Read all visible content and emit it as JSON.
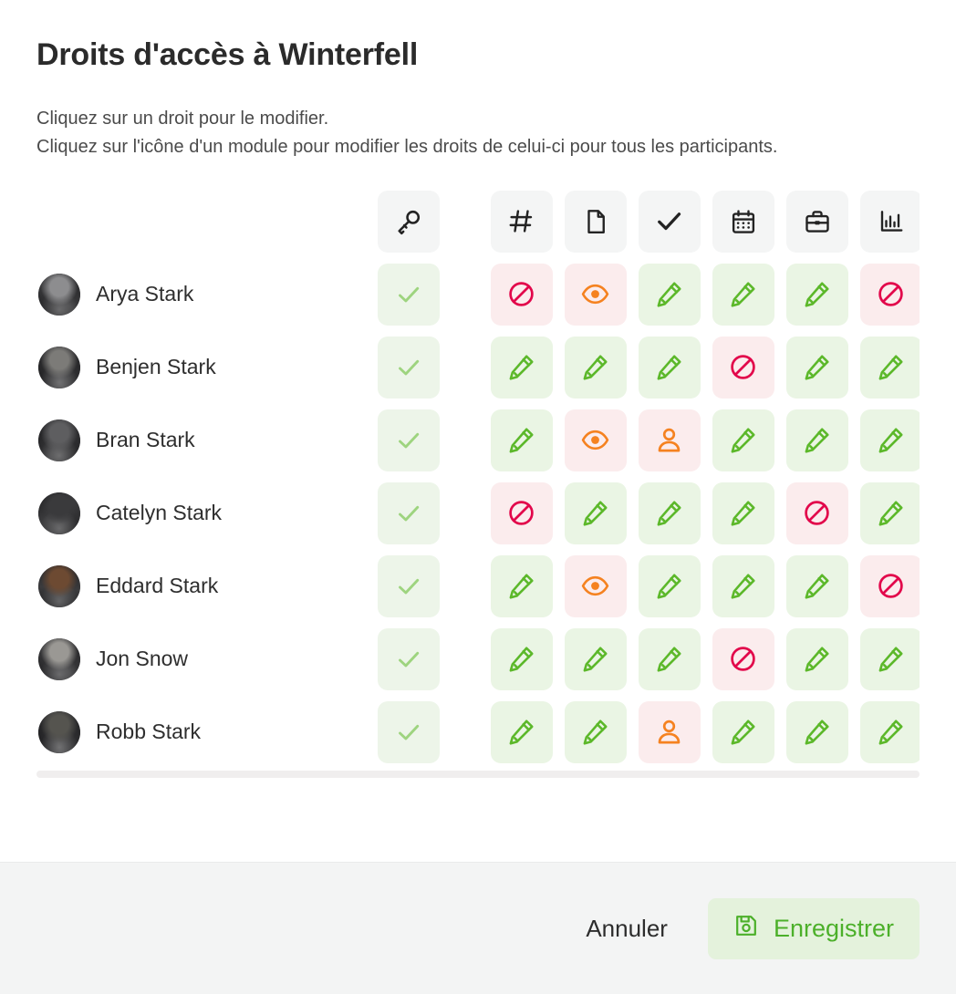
{
  "dialog": {
    "title": "Droits d'accès à Winterfell",
    "instructions": [
      "Cliquez sur un droit pour le modifier.",
      "Cliquez sur l'icône d'un module pour modifier les droits de celui-ci pour tous les participants."
    ]
  },
  "colors": {
    "allow_bg": "#eaf5e4",
    "allow_dim_bg": "#edf5e9",
    "deny_bg": "#fbeced",
    "header_tile_bg": "#f4f5f5",
    "green": "#5cb82a",
    "green_dim": "#9ed47f",
    "crimson": "#e2074b",
    "orange": "#f58220",
    "footer_bg": "#f3f4f4",
    "save_bg": "#e4f2dc",
    "save_fg": "#4cb02a"
  },
  "columns": [
    {
      "key": "access",
      "icon": "key-icon",
      "label": "Accès"
    },
    {
      "key": "channel",
      "icon": "hash-icon",
      "label": "Canal"
    },
    {
      "key": "files",
      "icon": "document-icon",
      "label": "Documents"
    },
    {
      "key": "tasks",
      "icon": "check-icon",
      "label": "Tâches"
    },
    {
      "key": "calendar",
      "icon": "calendar-icon",
      "label": "Calendrier"
    },
    {
      "key": "projects",
      "icon": "briefcase-icon",
      "label": "Projets"
    },
    {
      "key": "reports",
      "icon": "chart-icon",
      "label": "Rapports"
    }
  ],
  "permission_types": {
    "check": {
      "icon": "check-icon",
      "state": "allow-dim"
    },
    "edit": {
      "icon": "pencil-icon",
      "state": "allow"
    },
    "view": {
      "icon": "eye-icon",
      "state": "deny"
    },
    "self": {
      "icon": "person-icon",
      "state": "deny"
    },
    "none": {
      "icon": "ban-icon",
      "state": "deny"
    }
  },
  "participants": [
    {
      "name": "Arya Stark",
      "avatar_tone": "#8d8d8f",
      "permissions": [
        "check",
        "none",
        "view",
        "edit",
        "edit",
        "edit",
        "none"
      ]
    },
    {
      "name": "Benjen Stark",
      "avatar_tone": "#7c7b78",
      "permissions": [
        "check",
        "edit",
        "edit",
        "edit",
        "none",
        "edit",
        "edit"
      ]
    },
    {
      "name": "Bran Stark",
      "avatar_tone": "#5e5e60",
      "permissions": [
        "check",
        "edit",
        "view",
        "self",
        "edit",
        "edit",
        "edit"
      ]
    },
    {
      "name": "Catelyn Stark",
      "avatar_tone": "#3a3a3c",
      "permissions": [
        "check",
        "none",
        "edit",
        "edit",
        "edit",
        "none",
        "edit"
      ]
    },
    {
      "name": "Eddard Stark",
      "avatar_tone": "#6d4a32",
      "permissions": [
        "check",
        "edit",
        "view",
        "edit",
        "edit",
        "edit",
        "none"
      ]
    },
    {
      "name": "Jon Snow",
      "avatar_tone": "#9a9894",
      "permissions": [
        "check",
        "edit",
        "edit",
        "edit",
        "none",
        "edit",
        "edit"
      ]
    },
    {
      "name": "Robb Stark",
      "avatar_tone": "#55544f",
      "permissions": [
        "check",
        "edit",
        "edit",
        "self",
        "edit",
        "edit",
        "edit"
      ]
    }
  ],
  "footer": {
    "cancel_label": "Annuler",
    "save_label": "Enregistrer",
    "save_icon": "save-icon"
  }
}
